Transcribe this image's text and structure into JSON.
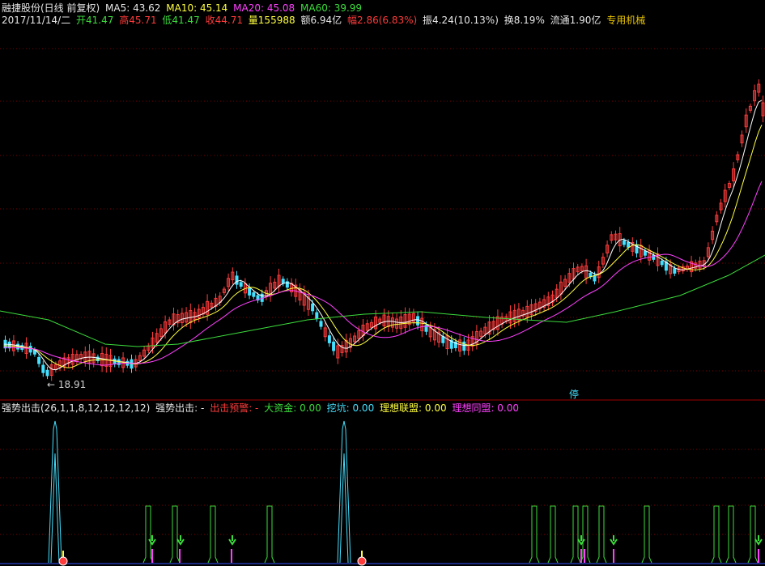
{
  "header": {
    "stock": "融捷股份(日线 前复权)",
    "ma5": "MA5: 43.62",
    "ma10": "MA10: 45.14",
    "ma20": "MA20: 45.08",
    "ma60": "MA60: 39.99"
  },
  "quote": {
    "date": "2017/11/14/二",
    "open": "开41.47",
    "high": "高45.71",
    "low": "低41.47",
    "close": "收44.71",
    "volume": "量155988",
    "amount": "额6.94亿",
    "change": "幅2.86(6.83%)",
    "amplitude": "振4.24(10.13%)",
    "turnover": "换8.19%",
    "float": "流通1.90亿",
    "sector": "专用机械"
  },
  "indicator": {
    "name": "强势出击(26,1,1,8,12,12,12,12)",
    "label": "强势出击: -",
    "warn": "出击预警: -",
    "bigfund": "大资金: 0.00",
    "dig": "挖坑: 0.00",
    "alliance": "理想联盟: 0.00",
    "together": "理想同盟: 0.00"
  },
  "annotations": {
    "low_price": "18.91",
    "limit_stop": "停"
  },
  "colors": {
    "up": "#ff3b3b",
    "down": "#44e0ff",
    "ma5": "#ffffff",
    "ma10": "#ffff40",
    "ma20": "#ff40ff",
    "ma60": "#3cdc3c",
    "separator": "#a00000"
  }
}
